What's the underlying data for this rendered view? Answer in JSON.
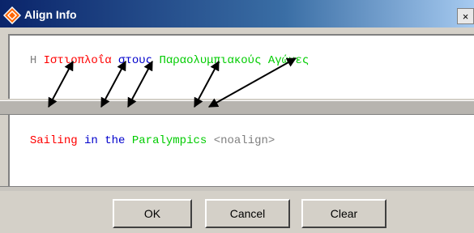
{
  "window": {
    "title": "Align Info",
    "close_label": "×"
  },
  "colors": {
    "red": "#ff0000",
    "blue": "#0000cc",
    "green": "#00cc00",
    "gray": "#808080",
    "title_bar": "#0a246a"
  },
  "source": {
    "tokens": [
      {
        "text": "Η",
        "color": "gray"
      },
      {
        "text": "Ιστιοπλοΐα",
        "color": "red"
      },
      {
        "text": "στους",
        "color": "blue"
      },
      {
        "text": "Παραολυμπιακούς",
        "color": "green"
      },
      {
        "text": "Αγώνες",
        "color": "green"
      }
    ]
  },
  "target": {
    "tokens": [
      {
        "text": "Sailing",
        "color": "red"
      },
      {
        "text": "in",
        "color": "blue"
      },
      {
        "text": "the",
        "color": "blue"
      },
      {
        "text": "Paralympics",
        "color": "green"
      },
      {
        "text": "<noalign>",
        "color": "gray"
      }
    ]
  },
  "buttons": {
    "ok": "OK",
    "cancel": "Cancel",
    "clear": "Clear"
  },
  "alignment_links": [
    {
      "from": "Ιστιοπλοΐα",
      "to": "Sailing"
    },
    {
      "from": "στους",
      "to": "in"
    },
    {
      "from": "στους",
      "to": "the"
    },
    {
      "from": "Παραολυμπιακούς",
      "to": "Paralympics"
    },
    {
      "from": "Αγώνες",
      "to": "Paralympics"
    }
  ]
}
